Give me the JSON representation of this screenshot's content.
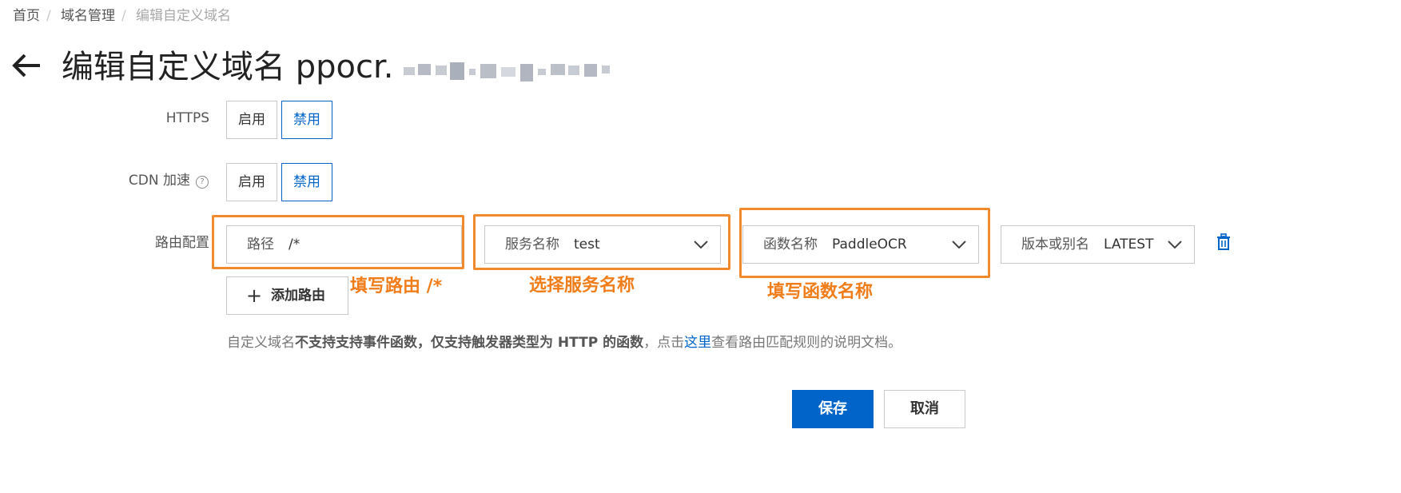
{
  "breadcrumb": [
    "首页",
    "域名管理",
    "编辑自定义域名"
  ],
  "page_title": "编辑自定义域名 ppocr.",
  "https": {
    "label": "HTTPS",
    "options": [
      "启用",
      "禁用"
    ],
    "selected": "禁用"
  },
  "cdn": {
    "label": "CDN 加速",
    "help": "?",
    "options": [
      "启用",
      "禁用"
    ],
    "selected": "禁用"
  },
  "route": {
    "label": "路由配置",
    "path": {
      "key": "路径",
      "value": "/*"
    },
    "service": {
      "key": "服务名称",
      "value": "test"
    },
    "function": {
      "key": "函数名称",
      "value": "PaddleOCR"
    },
    "version": {
      "key": "版本或别名",
      "value": "LATEST"
    },
    "add_label": "添加路由"
  },
  "annotations": {
    "path": "填写路由 /*",
    "service": "选择服务名称",
    "function": "填写函数名称"
  },
  "note": {
    "prefix": "自定义域名",
    "bold": "不支持支持事件函数，仅支持触发器类型为 HTTP 的函数",
    "middle": "，点击",
    "link": "这里",
    "suffix": "查看路由匹配规则的说明文档。"
  },
  "buttons": {
    "save": "保存",
    "cancel": "取消"
  },
  "colors": {
    "primary": "#0064c8",
    "annotation": "#f08a2c"
  }
}
